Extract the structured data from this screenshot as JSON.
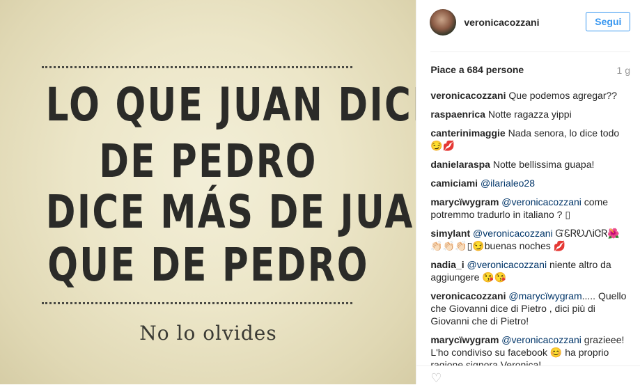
{
  "image": {
    "quote_lines": [
      "LO QUE JUAN DICE",
      "DE PEDRO",
      "DICE MÁS DE JUAN",
      "QUE DE PEDRO"
    ],
    "signature": "No lo olvides"
  },
  "header": {
    "username": "veronicacozzani",
    "follow_label": "Segui",
    "follow_color": "#3897f0"
  },
  "likes": {
    "text": "Piace a 684 persone",
    "time": "1 g"
  },
  "comments": [
    {
      "user": "veronicacozzani",
      "parts": [
        {
          "t": "text",
          "v": "Que podemos agregar??"
        }
      ]
    },
    {
      "user": "raspaenrica",
      "parts": [
        {
          "t": "text",
          "v": "Notte ragazza yippi"
        }
      ]
    },
    {
      "user": "canterinimaggie",
      "parts": [
        {
          "t": "text",
          "v": "Nada senora, lo dice todo 😏💋"
        }
      ]
    },
    {
      "user": "danielaraspa",
      "parts": [
        {
          "t": "text",
          "v": "Notte bellissima guapa!"
        }
      ]
    },
    {
      "user": "camiciami",
      "parts": [
        {
          "t": "mention",
          "v": "@ilarialeo28"
        }
      ]
    },
    {
      "user": "marycïwygram",
      "parts": [
        {
          "t": "mention",
          "v": "@veronicacozzani"
        },
        {
          "t": "text",
          "v": " come potremmo tradurlo in italiano ? ▯"
        }
      ]
    },
    {
      "user": "simylant",
      "parts": [
        {
          "t": "mention",
          "v": "@veronicacozzani"
        },
        {
          "t": "text",
          "v": " ᏳᏋᏒᎧᏁᎥᏣᏒ🌺 👏🏻👏🏻👏🏻▯😏buenas noches 💋"
        }
      ]
    },
    {
      "user": "nadia_i",
      "parts": [
        {
          "t": "mention",
          "v": "@veronicacozzani"
        },
        {
          "t": "text",
          "v": " niente altro da aggiungere 😘😘"
        }
      ]
    },
    {
      "user": "veronicacozzani",
      "parts": [
        {
          "t": "mention",
          "v": "@marycïwygram"
        },
        {
          "t": "text",
          "v": "..... Quello che Giovanni dice di Pietro , dici più di Giovanni che di Pietro!"
        }
      ]
    },
    {
      "user": "marycïwygram",
      "parts": [
        {
          "t": "mention",
          "v": "@veronicacozzani"
        },
        {
          "t": "text",
          "v": " grazieee! L'ho condiviso su facebook 😊 ha proprio ragione signora Veronica!"
        }
      ]
    }
  ]
}
